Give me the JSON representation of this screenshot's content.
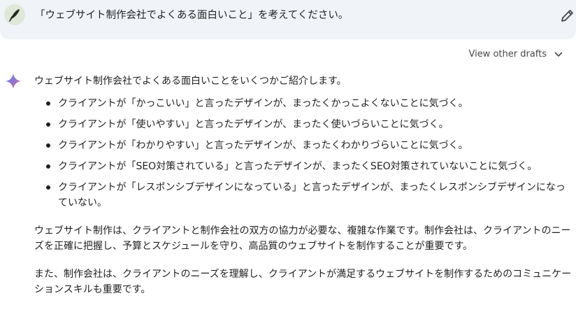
{
  "prompt": {
    "text": "「ウェブサイト制作会社でよくある面白いこと」を考えてください。",
    "avatar_icon": "quill-pen-icon",
    "edit_icon": "pencil-icon"
  },
  "drafts": {
    "label": "View other drafts",
    "icon": "chevron-down-icon"
  },
  "response": {
    "icon": "sparkle-icon",
    "intro": "ウェブサイト制作会社でよくある面白いことをいくつかご紹介します。",
    "bullets": [
      "クライアントが「かっこいい」と言ったデザインが、まったくかっこよくないことに気づく。",
      "クライアントが「使いやすい」と言ったデザインが、まったく使いづらいことに気づく。",
      "クライアントが「わかりやすい」と言ったデザインが、まったくわかりづらいことに気づく。",
      "クライアントが「SEO対策されている」と言ったデザインが、まったくSEO対策されていないことに気づく。",
      "クライアントが「レスポンシブデザインになっている」と言ったデザインが、まったくレスポンシブデザインになっていない。"
    ],
    "paragraph1": "ウェブサイト制作は、クライアントと制作会社の双方の協力が必要な、複雑な作業です。制作会社は、クライアントのニーズを正確に把握し、予算とスケジュールを守り、高品質のウェブサイトを制作することが重要です。",
    "paragraph2": "また、制作会社は、クライアントのニーズを理解し、クライアントが満足するウェブサイトを制作するためのコミュニケーションスキルも重要です。"
  },
  "colors": {
    "prompt_bg": "#f0f4f9",
    "text": "#1f1f1f",
    "sparkle_blue": "#4285f4",
    "sparkle_red": "#d96570"
  }
}
